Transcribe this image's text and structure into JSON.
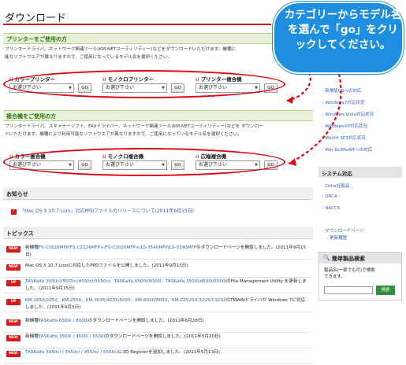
{
  "page": {
    "title": "ダウンロード"
  },
  "printer_section": {
    "heading": "プリンターをご使用の方",
    "desc_line1": "プリンタードライバ、ネットワーク関連ツール(KM-NETユーティリティー)などをダウンロードいただけます。機種に",
    "desc_line2": "能なソフトウエアが異なりますので、ご使用になっているモデル名を選択ください。",
    "groups": [
      {
        "label": "カラープリンター",
        "select": "お選び下さい",
        "go": "GO"
      },
      {
        "label": "モノクロプリンター",
        "select": "お選び下さい",
        "go": "GO"
      },
      {
        "label": "プリンター複合機",
        "select": "お選び下さい",
        "go": "GO"
      }
    ]
  },
  "mfp_section": {
    "heading": "複合機をご使用の方",
    "desc_line1": "プリンタードライバ、スキャナーソフト、FAXドライバー、ネットワーク関連ツール(KM-NETユーティリティー)などを ダウンロー",
    "desc_line2": "ドいただけます。機種により利用可能なソフトウエアが異なりますので、ご使用になっているモデル名を選択ください。",
    "groups": [
      {
        "label": "カラー複合機",
        "select": "お選び下さい",
        "go": "GO"
      },
      {
        "label": "モノクロ複合機",
        "select": "お選び下さい",
        "go": "GO"
      },
      {
        "label": "広幅複合機",
        "select": "お選び下さい",
        "go": "GO"
      }
    ]
  },
  "notice": {
    "heading": "お知らせ",
    "items": [
      {
        "text": "「Mac OS X 10.7 Lion」対応PPDファイルのリリースについて(2011年9月15日)"
      }
    ]
  },
  "topics": {
    "heading": "トピックス",
    "items": [
      {
        "badge": "NEW",
        "pre": "新機種",
        "link": "FS-C2626MFP/FS-C2126MFP+/FS-C2026MFP+/LS-3540MFP/LS-3140MFP",
        "post": "のダウンロードページを開設しました。(2011年9月15日)"
      },
      {
        "badge": "NEW",
        "pre": "Mac OS X 10.7 Lionに対応したPPDファイルを公開しました。(2011年9月15日)",
        "link": "",
        "post": ""
      },
      {
        "badge": "UP",
        "pre": "",
        "link": "TASKalfa 3050ci/3550ci/4550ci/5550ci、TASKalfa 6500i/8000i、TASKalfa 3500i/4500i/5500i",
        "post": "のFile Management Utility を更新しました。(2011年9月15日)"
      },
      {
        "badge": "UP",
        "pre": "",
        "link": "KM-1650/2050、KM-2550、KM-3035/4035/5035、KM-6030/8030、KM-C2520/C3225/C3232",
        "post": "のTWAINドライバが Windows 7に対応しました。(2011年9月5日)"
      },
      {
        "badge": "NEW",
        "pre": "新機種",
        "link": "TASKalfa 6500i / 8000i",
        "post": "のダウンロードページを開設しました。(2011年6月28日)"
      },
      {
        "badge": "NEW",
        "pre": "新機種",
        "link": "TASKalfa 3500i / 4500i / 5500i",
        "post": "のダウンロードページを開設しました。(2011年5月20日)"
      },
      {
        "badge": "NEW",
        "pre": "",
        "link": "TASKalfa 3050ci / 3550ci / 4550ci / 5550ci",
        "post": "に3D Registerを追加しました。(2011年5月13日)"
      }
    ]
  },
  "callout": {
    "text": "カテゴリーからモデル名を選んで「go」をクリックしてください。"
  },
  "side_os": [
    {
      "label": "新規版OSへの対応"
    },
    {
      "label": "Windows7対応状況"
    },
    {
      "label": "Windows Vista対応状況"
    },
    {
      "label": "WindowsXP対応状況"
    },
    {
      "label": "WinXP SP3対応状況"
    },
    {
      "label": "Win 9x/Me/NTへの対応"
    }
  ],
  "side_system": {
    "heading": "システム対応",
    "items": [
      {
        "label": "Citrix社製品"
      },
      {
        "label": "ORCA"
      },
      {
        "label": "NACCS"
      }
    ]
  },
  "side_misc": [
    {
      "label": "ダウンロードページ"
    },
    {
      "label": "更新履歴"
    }
  ],
  "quick_search": {
    "heading": "簡単製品検索",
    "text1": "製品名(一部でも可)で検索",
    "text2": "できます。",
    "button": "検索"
  }
}
